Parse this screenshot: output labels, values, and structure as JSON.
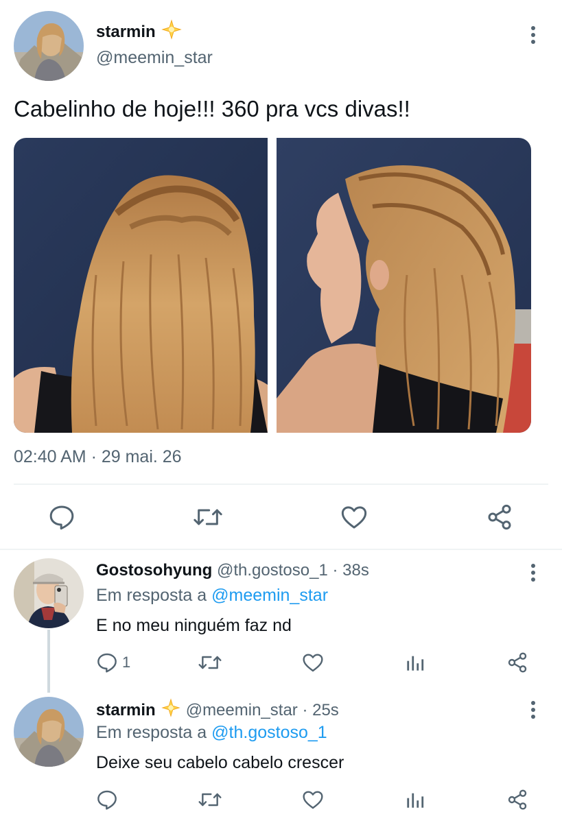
{
  "main_tweet": {
    "author_name": "starmin",
    "verified_emoji": "star-emoji",
    "handle": "@meemin_star",
    "text": "Cabelinho de hoje!!! 360 pra vcs divas!!",
    "timestamp": "02:40 AM · 29 mai. 26",
    "actions": [
      "reply-icon",
      "retweet-icon",
      "like-icon",
      "share-icon"
    ]
  },
  "replies": [
    {
      "author_name": "Gostosohyung",
      "handle_time": "@th.gostoso_1 · 38s",
      "reply_prefix": "Em resposta a",
      "reply_to": "@meemin_star",
      "text": "E no meu ninguém faz nd",
      "reply_count": "1"
    },
    {
      "author_name": "starmin",
      "handle_time": "@meemin_star · 25s",
      "reply_prefix": "Em resposta a",
      "reply_to": "@th.gostoso_1",
      "text": "Deixe seu cabelo cabelo crescer",
      "reply_count": ""
    }
  ],
  "colors": {
    "text": "#0f1419",
    "secondary": "#536471",
    "accent": "#1d9bf0",
    "divider": "#eff3f4",
    "photo_background": "#2c3b59",
    "hair": "#c8955a"
  }
}
